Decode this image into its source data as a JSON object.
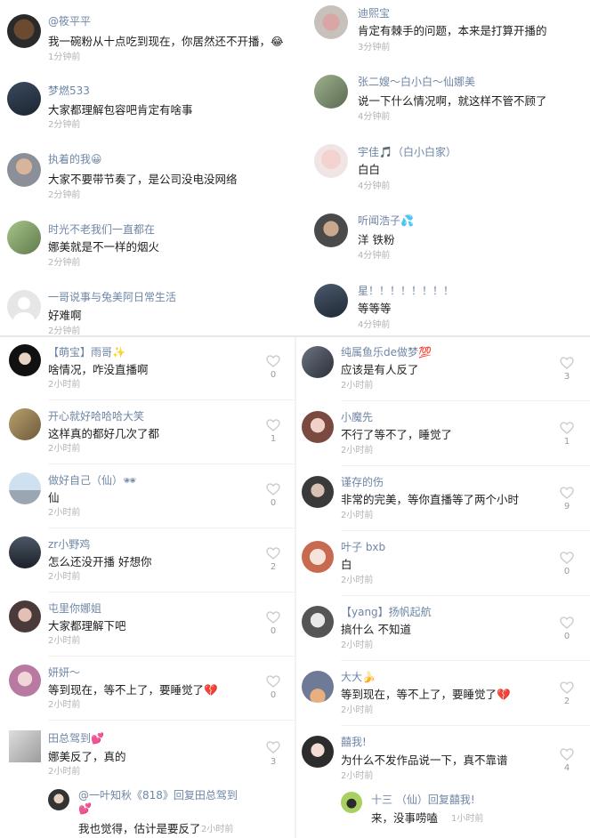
{
  "top_left": [
    {
      "user": "@筱平平",
      "text": "我一碗粉从十点吃到现在，你居然还不开播，😂",
      "time": "1分钟前"
    },
    {
      "user": "梦燃533",
      "text": "大家都理解包容吧肯定有啥事",
      "time": "2分钟前"
    },
    {
      "user": "执着的我😀",
      "text": "大家不要带节奏了，是公司没电没网络",
      "time": "2分钟前"
    },
    {
      "user": "时光不老我们一直都在",
      "text": "娜美就是不一样的烟火",
      "time": "2分钟前"
    },
    {
      "user": "一哥说事与兔美阿日常生活",
      "text": "好难啊",
      "time": "2分钟前"
    }
  ],
  "top_right": [
    {
      "user": "迪熙宝",
      "text": "肯定有棘手的问题，本来是打算开播的",
      "time": "3分钟前"
    },
    {
      "user": "张二嫂～白小白～仙娜美",
      "text": "说一下什么情况啊，就这样不管不顾了",
      "time": "4分钟前"
    },
    {
      "user": "宇佳🎵（白小白家）",
      "text": "白白",
      "time": "4分钟前"
    },
    {
      "user": "听闻浩子💦",
      "text": "洋 铁粉",
      "time": "4分钟前"
    },
    {
      "user": "星！！！！！！！！",
      "text": "等等等",
      "time": "4分钟前"
    }
  ],
  "bottom_left": [
    {
      "user": "【萌宝】雨哥✨",
      "text": "啥情况，咋没直播啊",
      "time": "2小时前",
      "likes": "0"
    },
    {
      "user": "开心就好哈哈哈大笑",
      "text": "这样真的都好几次了都",
      "time": "2小时前",
      "likes": "1"
    },
    {
      "user": "做好自己（仙）🕶",
      "text": "仙",
      "time": "2小时前",
      "likes": "0"
    },
    {
      "user": "zr小野鸡",
      "text": "怎么还没开播  好想你",
      "time": "2小时前",
      "likes": "2"
    },
    {
      "user": "屯里你娜姐",
      "text": "大家都理解下吧",
      "time": "2小时前",
      "likes": "0"
    },
    {
      "user": "妍妍～",
      "text": "等到现在，等不上了，要睡觉了💔",
      "time": "2小时前",
      "likes": "0"
    },
    {
      "user": "田总驾到💕",
      "text": "娜美反了，真的",
      "time": "2小时前",
      "likes": "3"
    }
  ],
  "bottom_left_reply": {
    "user": "@一叶知秋《818》回复田总驾到",
    "user2": "💕",
    "text": "我也觉得，估计是要反了",
    "time": "2小时前"
  },
  "bottom_right": [
    {
      "user": "纯属鱼乐de做梦💯",
      "text": "应该是有人反了",
      "time": "2小时前",
      "likes": "3"
    },
    {
      "user": "小魔先",
      "text": "不行了等不了，睡觉了",
      "time": "2小时前",
      "likes": "1"
    },
    {
      "user": "谨存的伤",
      "text": "非常的完美，等你直播等了两个小时",
      "time": "2小时前",
      "likes": "9"
    },
    {
      "user": "叶子 bxb",
      "text": "白",
      "time": "2小时前",
      "likes": "0"
    },
    {
      "user": "【yang】扬帆起航",
      "text": "搞什么  不知道",
      "time": "2小时前",
      "likes": "0"
    },
    {
      "user": "大大🍌",
      "text": "等到现在，等不上了，要睡觉了💔",
      "time": "2小时前",
      "likes": "2"
    },
    {
      "user": "囍我!",
      "text": "为什么不发作品说一下，真不靠谱",
      "time": "2小时前",
      "likes": "4"
    }
  ],
  "bottom_right_reply": {
    "user": "十三      （仙）回复囍我!",
    "text": "来，没事唠嗑",
    "time": "1小时前"
  },
  "colors": {
    "username": "#6f86a6",
    "time": "#b3b3b3",
    "text": "#1e1e1e",
    "heart": "#c8c8c8"
  }
}
